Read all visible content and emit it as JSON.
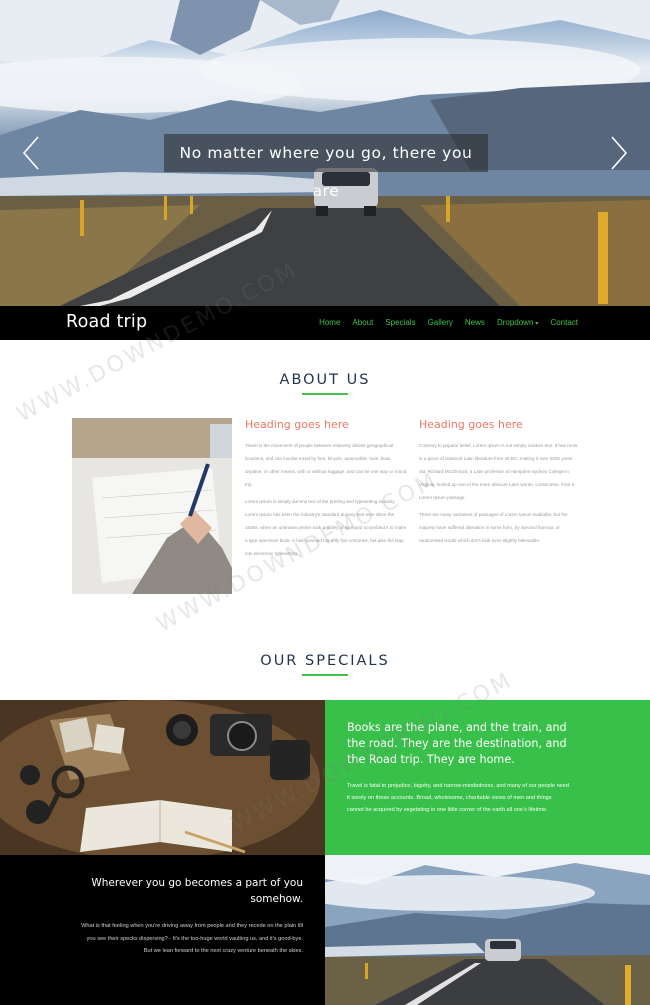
{
  "hero": {
    "caption": "No matter where you go, there you are",
    "prev_icon": "chevron-left-icon",
    "next_icon": "chevron-right-icon"
  },
  "navbar": {
    "brand": "Road trip",
    "items": [
      {
        "label": "Home"
      },
      {
        "label": "About"
      },
      {
        "label": "Specials"
      },
      {
        "label": "Gallery"
      },
      {
        "label": "News"
      },
      {
        "label": "Dropdown"
      },
      {
        "label": "Contact"
      }
    ],
    "accent_color": "#3ec24c"
  },
  "about": {
    "title": "ABOUT US",
    "columns": [
      {
        "heading": "Heading goes here",
        "paragraphs": [
          "Travel is the movement of people between relatively distant geographical locations, and can involve travel by foot, bicycle, automobile, train, boat, airplane, or other means, with or without luggage, and can be one way or round trip.",
          "Lorem Ipsum is simply dummy text of the printing and typesetting industry. Lorem Ipsum has been the industry's standard dummy text ever since the 1500s, when an unknown printer took a galley of type and scrambled it to make a type specimen book. It has survived not only five centuries, but also the leap into electronic typesetting."
        ]
      },
      {
        "heading": "Heading goes here",
        "paragraphs": [
          "Contrary to popular belief, Lorem Ipsum is not simply random text. It has roots in a piece of classical Latin literature from 45 BC, making it over 2000 years old. Richard McClintock, a Latin professor at Hampden-Sydney College in Virginia, looked up one of the more obscure Latin words, consectetur, from a Lorem Ipsum passage.",
          "There are many variations of passages of Lorem Ipsum available, but the majority have suffered alteration in some form, by injected humour, or randomised words which don't look even slightly believable."
        ]
      }
    ],
    "heading_color": "#ee7766"
  },
  "specials": {
    "title": "OUR SPECIALS",
    "green_tile": {
      "quote": "Books are the plane, and the train, and the road. They are the destination, and the Road trip. They are home.",
      "text": "Travel is fatal to prejudice, bigotry, and narrow-mindedness, and many of our people need it sorely on these accounts. Broad, wholesome, charitable views of men and things cannot be acquired by vegetating in one little corner of the earth all one's lifetime."
    },
    "black_tile": {
      "quote": "Wherever you go becomes a part of you somehow.",
      "text": "What is that feeling when you're driving away from people and they recede on the plain till you see their specks dispersing? - It's the too-huge world vaulting us, and it's good-bye. But we lean forward to the next crazy venture beneath the skies."
    },
    "green_color": "#39c04a"
  },
  "watermark": "WWW.DOWNDEMO.COM"
}
